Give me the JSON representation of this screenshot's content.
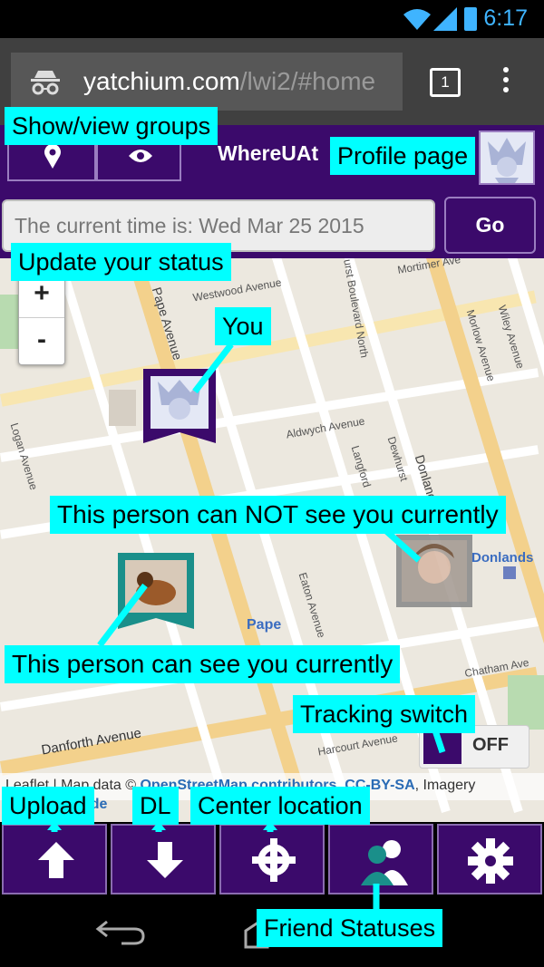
{
  "statusbar": {
    "time": "6:17"
  },
  "browser": {
    "url_host": "yatchium.com",
    "url_path": "/lwi2/#home",
    "tab_count": "1"
  },
  "header": {
    "title": "WhereUAt"
  },
  "status": {
    "input_value": "The current time is: Wed Mar 25 2015",
    "go_label": "Go"
  },
  "map": {
    "zoom_in": "+",
    "zoom_out": "-",
    "streets": [
      "Westwood Avenue",
      "Mortimer Ave",
      "Aldwych Avenue",
      "Danforth Avenue",
      "Harcourt Avenue",
      "Chatham Ave",
      "Donlands Ave",
      "Donlands",
      "Pape Avenue",
      "Pape",
      "Logan Avenue",
      "Eaton Avenue",
      "Langford",
      "Dewhurst",
      "Wiley Avenue",
      "Morlow Avenue",
      "urst Boulevard North"
    ],
    "attribution_prefix": "Leaflet | Map data ©",
    "attribution_osm": "OpenStreetMap contributors,",
    "attribution_license": "CC-BY-SA",
    "attribution_suffix": ", Imagery",
    "attribution_link": "ode"
  },
  "tracking": {
    "state": "OFF"
  },
  "callouts": {
    "show_groups": "Show/view groups",
    "profile": "Profile page",
    "update_status": "Update your status",
    "you": "You",
    "cannot_see": "This person can NOT see you currently",
    "can_see": "This person can see you currently",
    "tracking_switch": "Tracking switch",
    "upload": "Upload",
    "dl": "DL",
    "center": "Center location",
    "friend_statuses": "Friend Statuses"
  },
  "colors": {
    "brand_purple": "#3b0a6b",
    "callout_cyan": "#00ffff",
    "teal_marker": "#1a8f8a"
  },
  "icons": {
    "header": [
      "location-pin-icon",
      "eye-icon"
    ],
    "toolbar": [
      "upload-arrow-icon",
      "download-arrow-icon",
      "crosshair-icon",
      "friends-icon",
      "gear-icon"
    ]
  }
}
